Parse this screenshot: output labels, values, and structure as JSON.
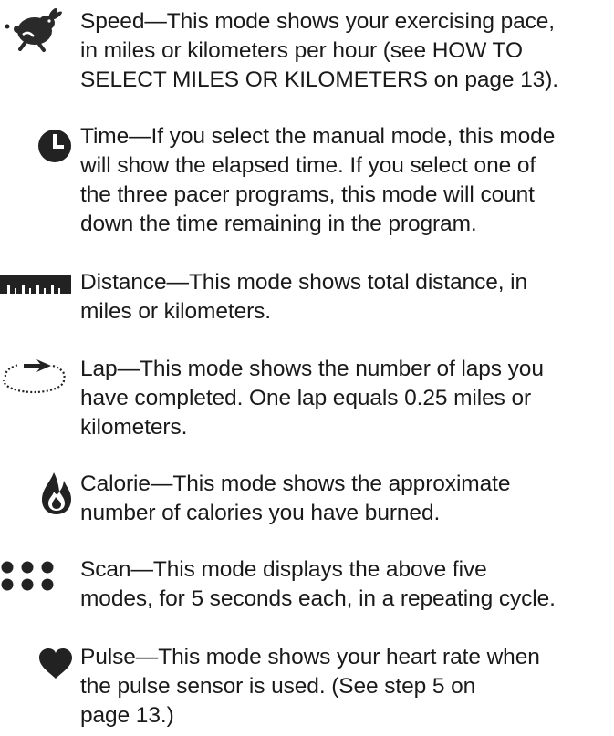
{
  "modes": [
    {
      "icon": "rabbit-icon",
      "name": "Speed",
      "lines": [
        "This mode shows your exercising pace,",
        "in miles or kilometers per hour (see HOW TO",
        "SELECT MILES OR KILOMETERS on page 13)."
      ]
    },
    {
      "icon": "clock-icon",
      "name": "Time",
      "lines": [
        "If you select the manual mode, this mode",
        "will show the elapsed time. If you select one of",
        "the three pacer programs, this mode will count",
        "down the time remaining in the program."
      ]
    },
    {
      "icon": "ruler-icon",
      "name": "Distance",
      "lines": [
        "This mode shows total distance, in",
        "miles or kilometers."
      ]
    },
    {
      "icon": "track-icon",
      "name": "Lap",
      "lines": [
        "This mode shows the number of laps you",
        "have completed. One lap equals 0.25 miles or",
        "kilometers."
      ]
    },
    {
      "icon": "flame-icon",
      "name": "Calorie",
      "lines": [
        "This mode shows the approximate",
        "number of calories you have burned."
      ]
    },
    {
      "icon": "dots-icon",
      "name": "Scan",
      "lines": [
        "This mode displays the above five",
        "modes, for 5 seconds each, in a repeating cycle."
      ]
    },
    {
      "icon": "heart-icon",
      "name": "Pulse",
      "lines": [
        "This mode shows your heart rate when",
        "the pulse sensor is used. (See step 5 on",
        "page 13.)"
      ]
    }
  ]
}
